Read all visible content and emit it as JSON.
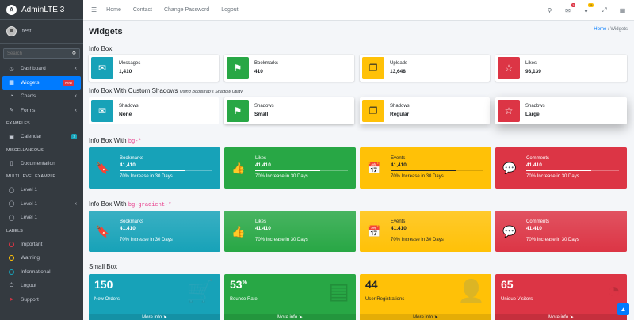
{
  "brand": {
    "name": "AdminLTE 3"
  },
  "user": {
    "name": "test"
  },
  "search": {
    "placeholder": "Search"
  },
  "nav": {
    "dashboard": "Dashboard",
    "widgets": "Widgets",
    "widgets_badge": "New",
    "charts": "Charts",
    "forms": "Forms",
    "hdr_examples": "EXAMPLES",
    "calendar": "Calendar",
    "calendar_badge": "2",
    "hdr_misc": "MISCELLANEOUS",
    "documentation": "Documentation",
    "hdr_multi": "MULTI LEVEL EXAMPLE",
    "level1a": "Level 1",
    "level1b": "Level 1",
    "level1c": "Level 1",
    "hdr_labels": "LABELS",
    "important": "Important",
    "warning": "Warning",
    "informational": "Informational",
    "logout": "Logout",
    "support": "Support"
  },
  "topnav": {
    "home": "Home",
    "contact": "Contact",
    "change_password": "Change Password",
    "logout": "Logout",
    "messages_badge": "3",
    "notifications_badge": "15"
  },
  "page": {
    "title": "Widgets",
    "breadcrumb_home": "Home",
    "breadcrumb_sep": "/",
    "breadcrumb_current": "Widgets"
  },
  "sections": {
    "infobox": "Info Box",
    "shadows": "Info Box With Custom Shadows",
    "shadows_note": "Using Bootstrap's Shadow Utility",
    "bg": "Info Box With",
    "bg_code": "bg-*",
    "gradient": "Info Box With",
    "gradient_code": "bg-gradient-*",
    "smallbox": "Small Box"
  },
  "infoboxes": [
    {
      "label": "Messages",
      "value": "1,410",
      "color": "#17a2b8",
      "icon": "envelope-icon"
    },
    {
      "label": "Bookmarks",
      "value": "410",
      "color": "#28a745",
      "icon": "flag-icon"
    },
    {
      "label": "Uploads",
      "value": "13,648",
      "color": "#ffc107",
      "icon": "copy-icon"
    },
    {
      "label": "Likes",
      "value": "93,139",
      "color": "#dc3545",
      "icon": "star-icon"
    }
  ],
  "shadowboxes": [
    {
      "label": "Shadows",
      "value": "None"
    },
    {
      "label": "Shadows",
      "value": "Small"
    },
    {
      "label": "Shadows",
      "value": "Regular"
    },
    {
      "label": "Shadows",
      "value": "Large"
    }
  ],
  "bgboxes": [
    {
      "label": "Bookmarks",
      "value": "41,410",
      "note": "70% Increase in 30 Days",
      "progress": 0.7
    },
    {
      "label": "Likes",
      "value": "41,410",
      "note": "70% Increase in 30 Days",
      "progress": 0.7
    },
    {
      "label": "Events",
      "value": "41,410",
      "note": "70% Increase in 30 Days",
      "progress": 0.7
    },
    {
      "label": "Comments",
      "value": "41,410",
      "note": "70% Increase in 30 Days",
      "progress": 0.7
    }
  ],
  "gradboxes": [
    {
      "label": "Bookmarks",
      "value": "41,410",
      "note": "70% Increase in 30 Days",
      "progress": 0.7
    },
    {
      "label": "Likes",
      "value": "41,410",
      "note": "70% Increase in 30 Days",
      "progress": 0.7
    },
    {
      "label": "Events",
      "value": "41,410",
      "note": "70% Increase in 30 Days",
      "progress": 0.7
    },
    {
      "label": "Comments",
      "value": "41,410",
      "note": "70% Increase in 30 Days",
      "progress": 0.7
    }
  ],
  "smallboxes": [
    {
      "number": "150",
      "sup": "",
      "label": "New Orders",
      "more": "More info"
    },
    {
      "number": "53",
      "sup": "%",
      "label": "Bounce Rate",
      "more": "More info"
    },
    {
      "number": "44",
      "sup": "",
      "label": "User Registrations",
      "more": "More info"
    },
    {
      "number": "65",
      "sup": "",
      "label": "Unique Visitors",
      "more": "More info"
    }
  ],
  "colors": {
    "info": "#17a2b8",
    "success": "#28a745",
    "warning": "#ffc107",
    "danger": "#dc3545",
    "primary": "#007bff",
    "sidebar": "#343a40"
  }
}
